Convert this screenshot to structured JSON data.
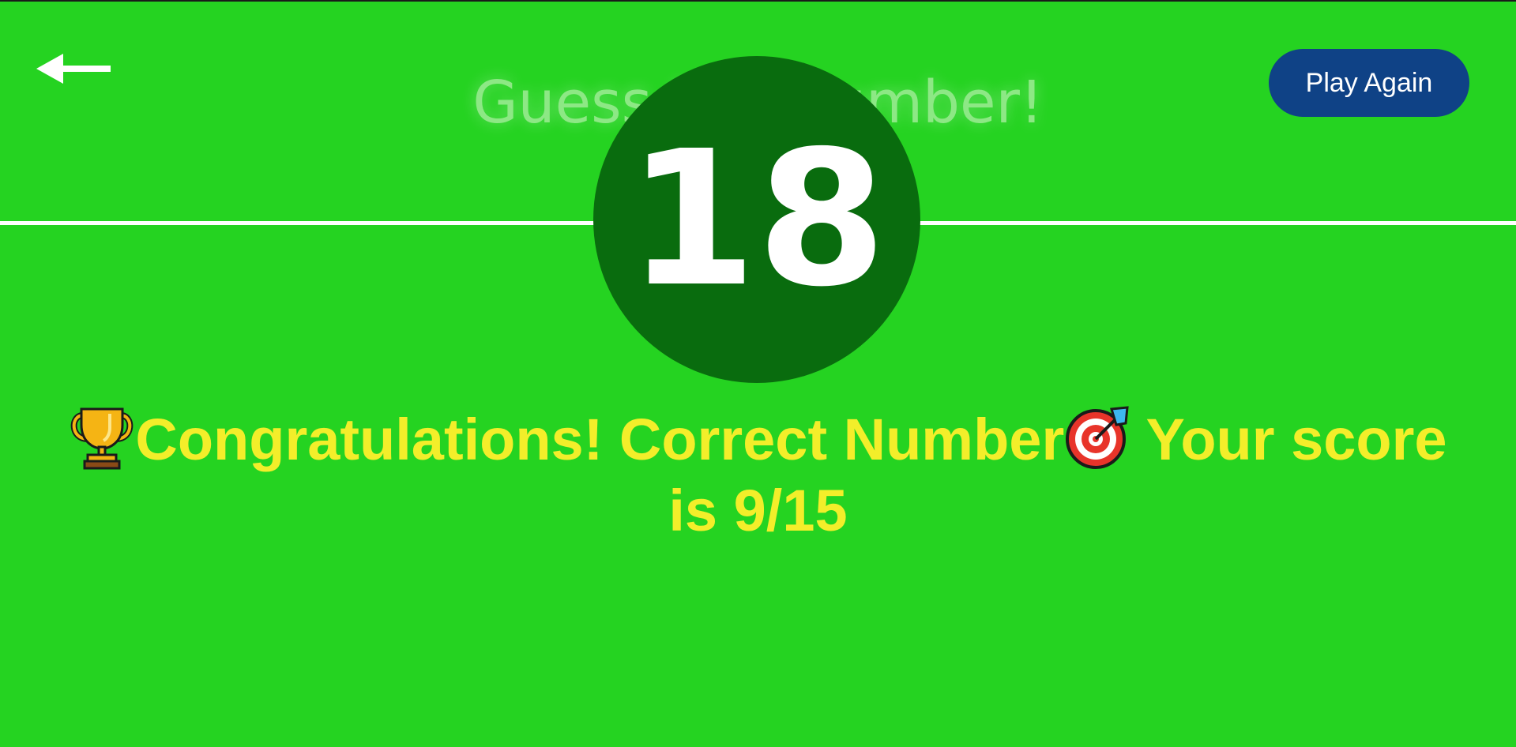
{
  "header": {
    "title": "Guess the Number!",
    "play_again_label": "Play Again",
    "back_icon": "arrow-left-icon"
  },
  "game": {
    "secret_number": "18",
    "result": {
      "trophy_icon": "trophy-icon",
      "part1": "Congratulations! Correct Number",
      "target_icon": "direct-hit-icon",
      "part2": " Your score is 9/15"
    }
  },
  "colors": {
    "background": "#25d321",
    "circle": "#096c0e",
    "button": "#0f4286",
    "message": "#f3ee2a",
    "title": "#8de885"
  }
}
